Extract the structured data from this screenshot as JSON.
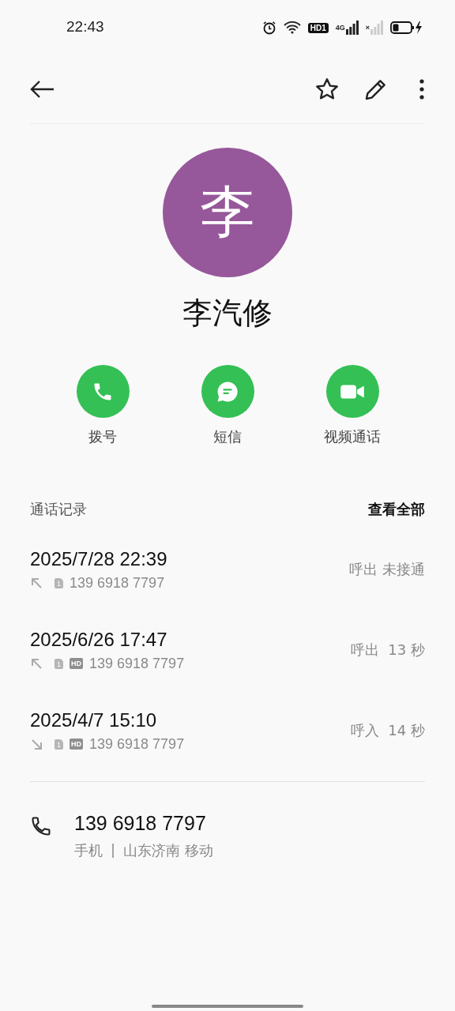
{
  "status_bar": {
    "time": "22:43",
    "hd_badge": "HD1",
    "network": "4G",
    "sim2_mark": "×"
  },
  "contact": {
    "initial": "李",
    "name": "李汽修"
  },
  "actions": [
    {
      "kind": "call",
      "label": "拨号"
    },
    {
      "kind": "message",
      "label": "短信"
    },
    {
      "kind": "video",
      "label": "视频通话"
    }
  ],
  "call_log": {
    "title": "通话记录",
    "view_all": "查看全部",
    "entries": [
      {
        "datetime": "2025/7/28 22:39",
        "kind": "outgoing",
        "sim": "1",
        "number": "139 6918 7797",
        "status": "呼出 未接通"
      },
      {
        "datetime": "2025/6/26 17:47",
        "kind": "outgoing",
        "sim": "1",
        "hd": "HD",
        "number": "139 6918 7797",
        "status": "呼出  13 秒"
      },
      {
        "datetime": "2025/4/7 15:10",
        "kind": "incoming",
        "sim": "1",
        "hd": "HD",
        "number": "139 6918 7797",
        "status": "呼入  14 秒"
      }
    ]
  },
  "phone": {
    "number": "139 6918 7797",
    "type": "手机",
    "separator": "|",
    "location": "山东济南 移动"
  }
}
